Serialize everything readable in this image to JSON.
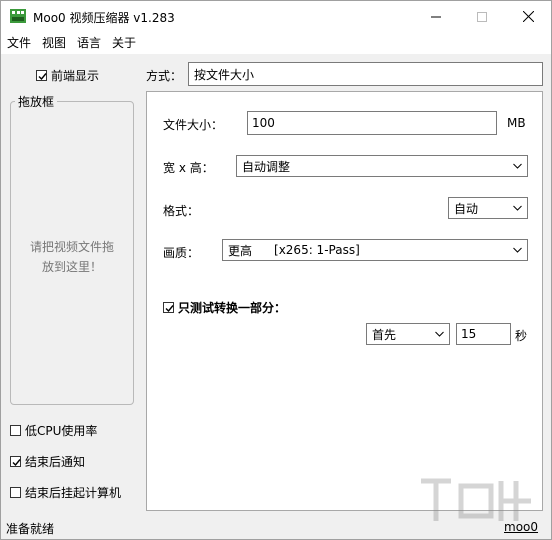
{
  "window": {
    "title": "Moo0 视频压缩器 v1.283",
    "colors": {
      "accent_green": "#3c9a3c",
      "panel_bg": "#ffffff",
      "window_bg": "#f0f0f0"
    }
  },
  "menu": [
    "文件",
    "视图",
    "语言",
    "关于"
  ],
  "left": {
    "always_on_top": {
      "label": "前端显示",
      "checked": true
    },
    "dropzone": {
      "title": "拖放框",
      "hint_line1": "请把视频文件拖",
      "hint_line2": "放到这里！"
    },
    "low_cpu": {
      "label": "低CPU使用率",
      "checked": false
    },
    "notify": {
      "label": "结束后通知",
      "checked": true
    },
    "hibernate": {
      "label": "结束后挂起计算机",
      "checked": false
    }
  },
  "mode": {
    "label": "方式：",
    "value": "按文件大小"
  },
  "settings": {
    "file_size": {
      "label": "文件大小：",
      "value": "100",
      "unit": "MB"
    },
    "dimensions": {
      "label": "宽 x 高：",
      "value": "自动调整"
    },
    "format": {
      "label": "格式：",
      "value": "自动"
    },
    "quality": {
      "label": "画质：",
      "value": "更高",
      "codec": "[x265: 1-Pass]"
    },
    "test_part": {
      "label": "只测试转换一部分：",
      "checked": true
    },
    "part_position": {
      "value": "首先"
    },
    "part_seconds": {
      "value": "15",
      "unit": "秒"
    }
  },
  "status": {
    "text": "准备就绪",
    "link": "moo0"
  }
}
